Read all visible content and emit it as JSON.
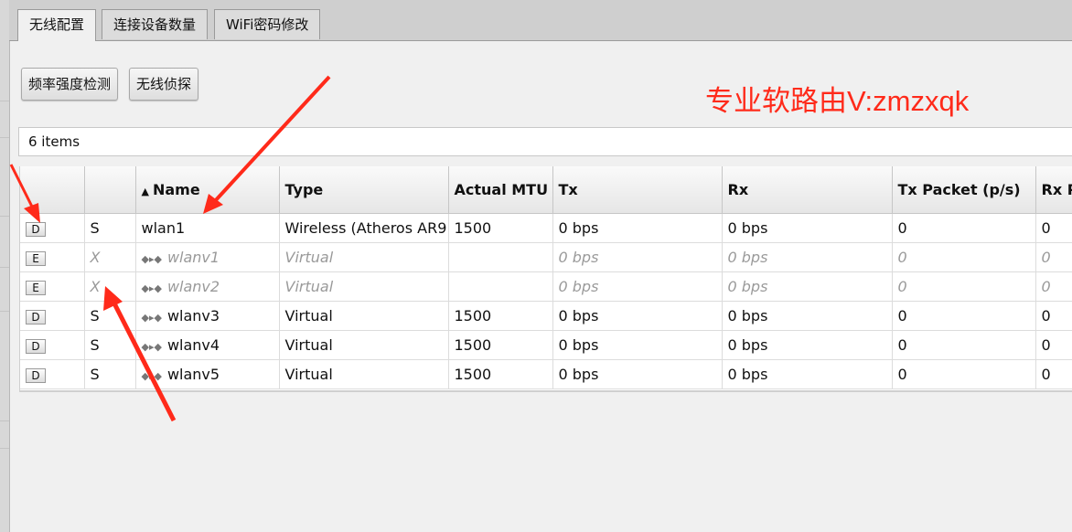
{
  "tabs": [
    {
      "label": "无线配置",
      "active": true
    },
    {
      "label": "连接设备数量",
      "active": false
    },
    {
      "label": "WiFi密码修改",
      "active": false
    }
  ],
  "buttons": {
    "freq_scan": "频率强度检测",
    "wireless_sniffer": "无线侦探"
  },
  "watermark": "专业软路由V:zmzxqk",
  "item_count": "6 items",
  "table": {
    "columns": [
      "",
      "",
      "Name",
      "Type",
      "Actual MTU",
      "Tx",
      "Rx",
      "Tx Packet (p/s)",
      "Rx P"
    ],
    "rows": [
      {
        "btn": "D",
        "flag": "S",
        "name": "wlan1",
        "type": "Wireless (Atheros AR9",
        "mtu": "1500",
        "tx": "0 bps",
        "rx": "0 bps",
        "txp": "0",
        "rxp": "0",
        "disabled": false,
        "virtual_icon": false
      },
      {
        "btn": "E",
        "flag": "X",
        "name": "wlanv1",
        "type": "Virtual",
        "mtu": "",
        "tx": "0 bps",
        "rx": "0 bps",
        "txp": "0",
        "rxp": "0",
        "disabled": true,
        "virtual_icon": true
      },
      {
        "btn": "E",
        "flag": "X",
        "name": "wlanv2",
        "type": "Virtual",
        "mtu": "",
        "tx": "0 bps",
        "rx": "0 bps",
        "txp": "0",
        "rxp": "0",
        "disabled": true,
        "virtual_icon": true
      },
      {
        "btn": "D",
        "flag": "S",
        "name": "wlanv3",
        "type": "Virtual",
        "mtu": "1500",
        "tx": "0 bps",
        "rx": "0 bps",
        "txp": "0",
        "rxp": "0",
        "disabled": false,
        "virtual_icon": true
      },
      {
        "btn": "D",
        "flag": "S",
        "name": "wlanv4",
        "type": "Virtual",
        "mtu": "1500",
        "tx": "0 bps",
        "rx": "0 bps",
        "txp": "0",
        "rxp": "0",
        "disabled": false,
        "virtual_icon": true
      },
      {
        "btn": "D",
        "flag": "S",
        "name": "wlanv5",
        "type": "Virtual",
        "mtu": "1500",
        "tx": "0 bps",
        "rx": "0 bps",
        "txp": "0",
        "rxp": "0",
        "disabled": false,
        "virtual_icon": true
      }
    ]
  },
  "colors": {
    "annotation": "#ff2a1a"
  },
  "icons": {
    "sort": "sort-ascending-icon",
    "virtual": "virtual-interface-icon"
  }
}
